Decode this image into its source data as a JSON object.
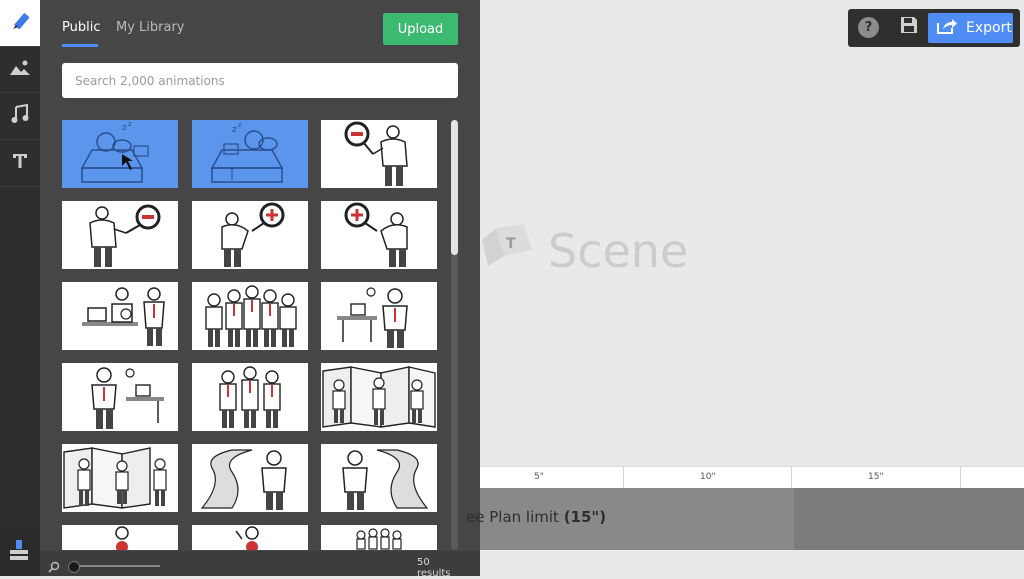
{
  "sidebar": {
    "items": [
      {
        "icon": "pencil-icon",
        "active": true
      },
      {
        "icon": "image-icon",
        "active": false
      },
      {
        "icon": "music-icon",
        "active": false
      },
      {
        "icon": "text-icon",
        "active": false
      }
    ],
    "bottom_icon": "stack-icon"
  },
  "library": {
    "tabs": [
      {
        "label": "Public",
        "active": true
      },
      {
        "label": "My Library",
        "active": false
      }
    ],
    "upload_label": "Upload",
    "search_placeholder": "Search 2,000 animations",
    "results_label": "50 results",
    "thumbnails": [
      {
        "scene": "sleeping-desk",
        "selected": true
      },
      {
        "scene": "sleeping-desk",
        "selected": true
      },
      {
        "scene": "magnifier-minus",
        "selected": false
      },
      {
        "scene": "magnifier-minus",
        "selected": false
      },
      {
        "scene": "magnifier-plus",
        "selected": false
      },
      {
        "scene": "magnifier-plus",
        "selected": false
      },
      {
        "scene": "office-meeting",
        "selected": false
      },
      {
        "scene": "group-crowd",
        "selected": false
      },
      {
        "scene": "standing-desk",
        "selected": false
      },
      {
        "scene": "stopwatch-desk",
        "selected": false
      },
      {
        "scene": "three-people",
        "selected": false
      },
      {
        "scene": "cubicles",
        "selected": false
      },
      {
        "scene": "cubicle-worker",
        "selected": false
      },
      {
        "scene": "road-figure",
        "selected": false
      },
      {
        "scene": "road-figure-2",
        "selected": false
      },
      {
        "scene": "presenter",
        "selected": false
      },
      {
        "scene": "presenter",
        "selected": false
      },
      {
        "scene": "crowd",
        "selected": false
      }
    ]
  },
  "topbar": {
    "help_label": "?",
    "export_label": "Export"
  },
  "canvas": {
    "placeholder_label": "Scene"
  },
  "timeline": {
    "ticks": [
      "5\"",
      "10\"",
      "15\""
    ],
    "limit_text": "ee Plan limit",
    "limit_value": "(15\")"
  },
  "colors": {
    "accent_blue": "#4f8df5",
    "upload_green": "#3cba72",
    "panel_bg": "#464646",
    "rail_bg": "#2e2e2e"
  }
}
